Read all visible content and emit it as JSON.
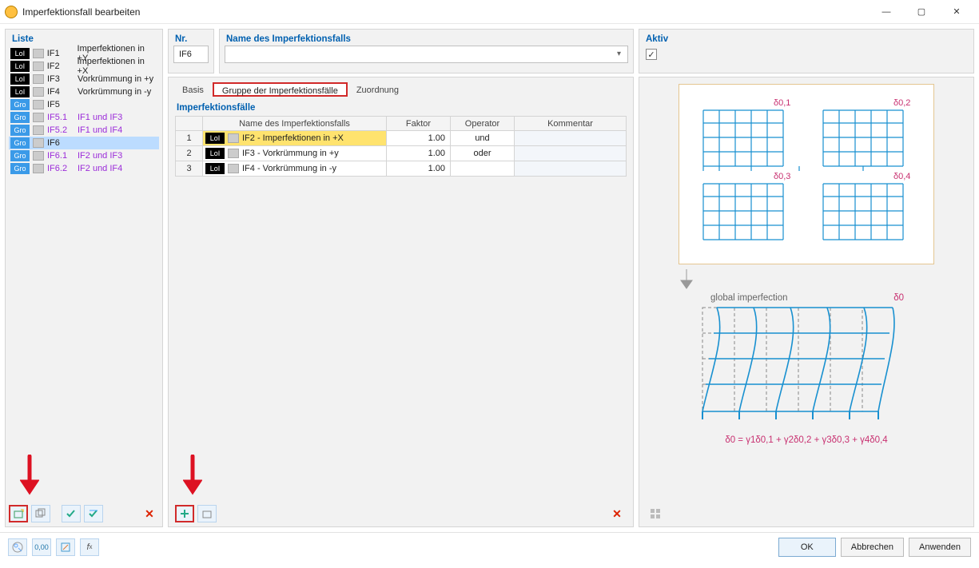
{
  "window": {
    "title": "Imperfektionsfall bearbeiten"
  },
  "liste": {
    "caption": "Liste",
    "rows": [
      {
        "badge": "LoI",
        "badgeCls": "lol",
        "id": "IF1",
        "sub": false,
        "desc": "Imperfektionen in +Y"
      },
      {
        "badge": "LoI",
        "badgeCls": "lol",
        "id": "IF2",
        "sub": false,
        "desc": "Imperfektionen in +X"
      },
      {
        "badge": "LoI",
        "badgeCls": "lol",
        "id": "IF3",
        "sub": false,
        "desc": "Vorkrümmung in +y"
      },
      {
        "badge": "LoI",
        "badgeCls": "lol",
        "id": "IF4",
        "sub": false,
        "desc": "Vorkrümmung in -y"
      },
      {
        "badge": "Gro",
        "badgeCls": "gro",
        "id": "IF5",
        "sub": false,
        "desc": ""
      },
      {
        "badge": "Gro",
        "badgeCls": "gro",
        "id": "IF5.1",
        "sub": true,
        "desc": "IF1 und IF3"
      },
      {
        "badge": "Gro",
        "badgeCls": "gro",
        "id": "IF5.2",
        "sub": true,
        "desc": "IF1 und IF4"
      },
      {
        "badge": "Gro",
        "badgeCls": "gro",
        "id": "IF6",
        "sub": false,
        "desc": "",
        "selected": true
      },
      {
        "badge": "Gro",
        "badgeCls": "gro",
        "id": "IF6.1",
        "sub": true,
        "desc": "IF2 und IF3"
      },
      {
        "badge": "Gro",
        "badgeCls": "gro",
        "id": "IF6.2",
        "sub": true,
        "desc": "IF2 und IF4"
      }
    ]
  },
  "nr": {
    "caption": "Nr.",
    "value": "IF6"
  },
  "nameField": {
    "caption": "Name des Imperfektionsfalls",
    "value": ""
  },
  "aktiv": {
    "caption": "Aktiv",
    "checked": true
  },
  "tabs": {
    "items": [
      {
        "label": "Basis",
        "active": false
      },
      {
        "label": "Gruppe der Imperfektionsfälle",
        "active": true
      },
      {
        "label": "Zuordnung",
        "active": false
      }
    ]
  },
  "subtitle": "Imperfektionsfälle",
  "table": {
    "headers": {
      "name": "Name des Imperfektionsfalls",
      "factor": "Faktor",
      "operator": "Operator",
      "comment": "Kommentar"
    },
    "rows": [
      {
        "n": "1",
        "badge": "LoI",
        "text": "IF2 - Imperfektionen in +X",
        "factor": "1.00",
        "op": "und",
        "sel": true
      },
      {
        "n": "2",
        "badge": "LoI",
        "text": "IF3 - Vorkrümmung in +y",
        "factor": "1.00",
        "op": "oder",
        "sel": false
      },
      {
        "n": "3",
        "badge": "LoI",
        "text": "IF4 - Vorkrümmung in -y",
        "factor": "1.00",
        "op": "",
        "sel": false
      }
    ]
  },
  "preview": {
    "labels": {
      "d01": "δ0,1",
      "d02": "δ0,2",
      "d03": "δ0,3",
      "d04": "δ0,4",
      "d0": "δ0",
      "global": "global imperfection"
    },
    "formula": "δ0 = γ1δ0,1 + γ2δ0,2 + γ3δ0,3 + γ4δ0,4"
  },
  "buttons": {
    "ok": "OK",
    "cancel": "Abbrechen",
    "apply": "Anwenden"
  }
}
